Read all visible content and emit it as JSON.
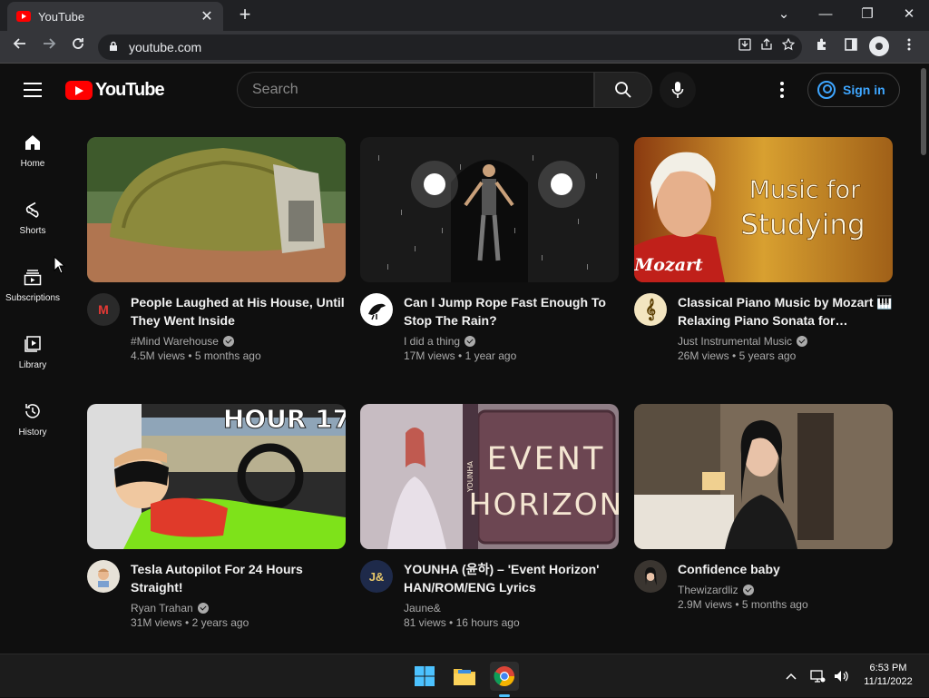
{
  "browser": {
    "tab_title": "YouTube",
    "tab_close": "✕",
    "new_tab": "+",
    "url": "youtube.com",
    "window_controls": [
      "⌄",
      "—",
      "❐",
      "✕"
    ]
  },
  "header": {
    "logo_text": "YouTube",
    "search_placeholder": "Search",
    "sign_in_label": "Sign in"
  },
  "sidebar": {
    "items": [
      {
        "label": "Home",
        "icon": "home-icon"
      },
      {
        "label": "Shorts",
        "icon": "shorts-icon"
      },
      {
        "label": "Subscriptions",
        "icon": "subscriptions-icon"
      },
      {
        "label": "Library",
        "icon": "library-icon"
      },
      {
        "label": "History",
        "icon": "history-icon"
      }
    ]
  },
  "videos": [
    {
      "title": "People Laughed at His House, Until They Went Inside",
      "channel": "#Mind Warehouse",
      "verified": true,
      "views": "4.5M views",
      "age": "5 months ago",
      "avatar": "M"
    },
    {
      "title": "Can I Jump Rope Fast Enough To Stop The Rain?",
      "channel": "I did a thing",
      "verified": true,
      "views": "17M views",
      "age": "1 year ago",
      "avatar": ""
    },
    {
      "title": "Classical Piano Music by Mozart 🎹 Relaxing Piano Sonata for…",
      "channel": "Just Instrumental Music",
      "verified": true,
      "views": "26M views",
      "age": "5 years ago",
      "avatar": "𝄞",
      "thumb_text": [
        "Music for",
        "Studying"
      ],
      "thumb_sub": "Mozart"
    },
    {
      "title": "Tesla Autopilot For 24 Hours Straight!",
      "channel": "Ryan Trahan",
      "verified": true,
      "views": "31M views",
      "age": "2 years ago",
      "avatar": "",
      "thumb_text": [
        "HOUR 17"
      ]
    },
    {
      "title": "YOUNHA (윤하) – 'Event Horizon' HAN/ROM/ENG Lyrics",
      "channel": "Jaune&",
      "verified": false,
      "views": "81 views",
      "age": "16 hours ago",
      "avatar": "J&",
      "thumb_text": [
        "EVENT",
        "HORIZON"
      ],
      "thumb_sub": "YOUNHA"
    },
    {
      "title": "Confidence baby",
      "channel": "Thewizardliz",
      "verified": true,
      "views": "2.9M views",
      "age": "5 months ago",
      "avatar": ""
    }
  ],
  "taskbar": {
    "time": "6:53 PM",
    "date": "11/11/2022"
  },
  "colors": {
    "brand_red": "#ff0000",
    "link_blue": "#3ea6ff",
    "bg": "#0f0f0f"
  }
}
